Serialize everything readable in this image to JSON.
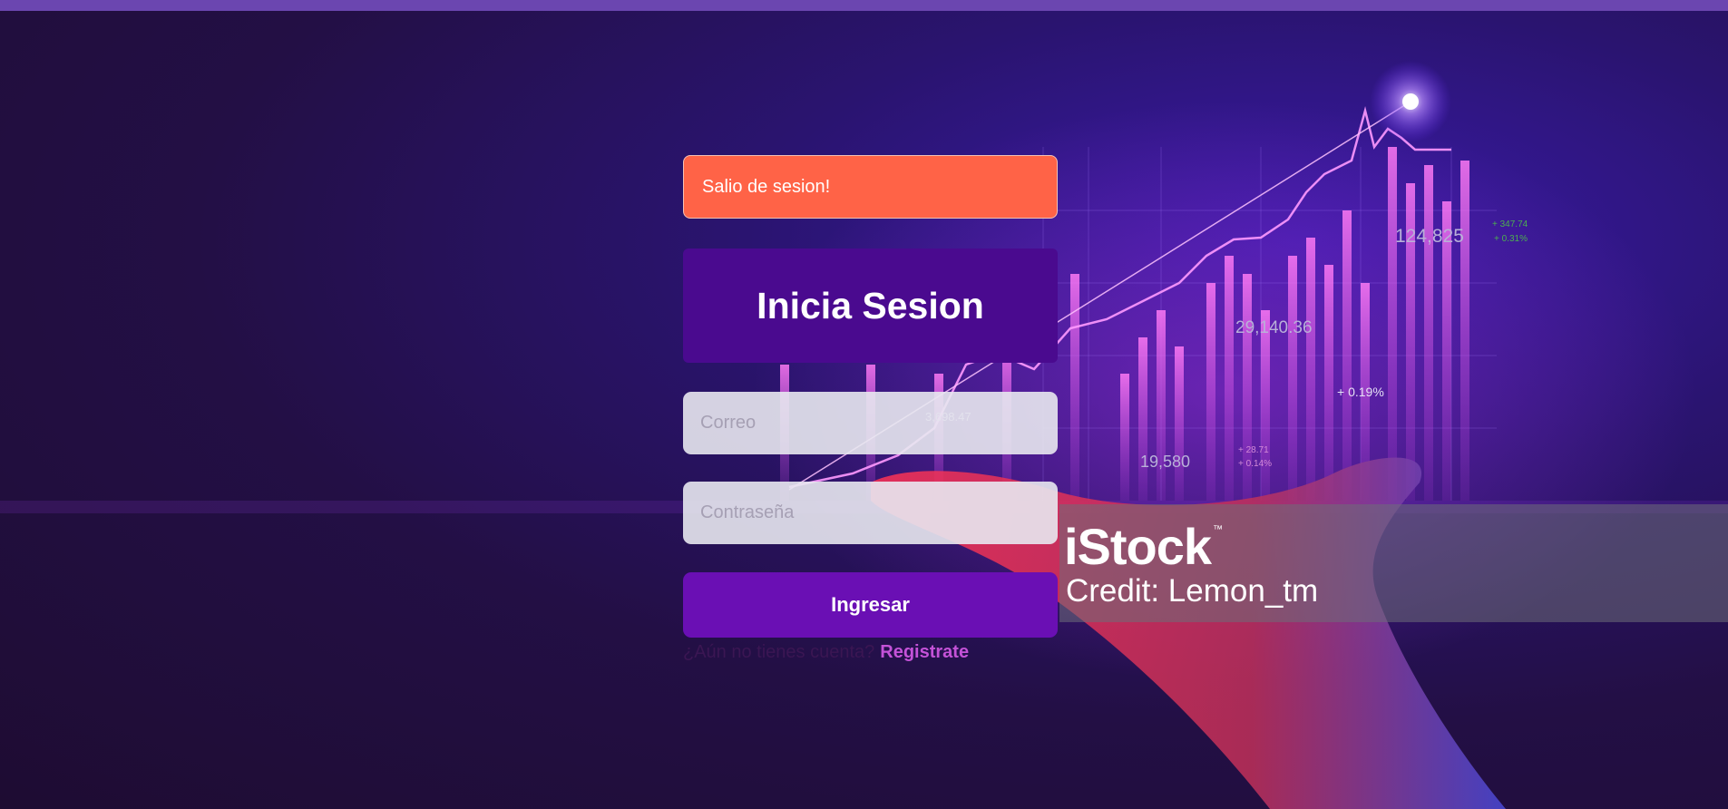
{
  "alert": {
    "message": "Salio de sesion!",
    "color": "#ff6347"
  },
  "login": {
    "title": "Inicia Sesion",
    "email_placeholder": "Correo",
    "password_placeholder": "Contraseña",
    "submit_label": "Ingresar",
    "register_prompt": "¿Aún no tienes cuenta?",
    "register_link": "Registrate"
  },
  "background": {
    "stats": [
      "124,825",
      "+ 347.74",
      "+ 0.31%",
      "29,140.36",
      "+ 0.19%",
      "3,698.47",
      "19,580",
      "+ 28.71",
      "+ 0.14%"
    ]
  },
  "watermark": {
    "brand": "iStock",
    "tm": "™",
    "credit": "Credit: Lemon_tm"
  },
  "colors": {
    "accent": "#6a0fb4",
    "title_bg": "#4a0a8f",
    "link": "#c452d8"
  }
}
